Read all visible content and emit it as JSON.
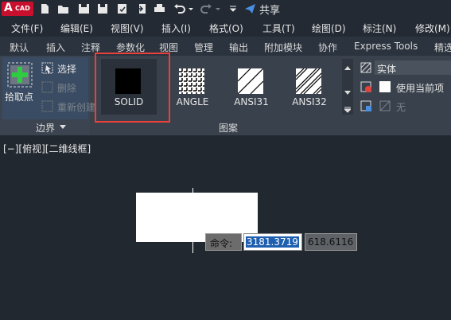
{
  "app": {
    "logo_letter": "A",
    "logo_sub": "CAD",
    "share": "共享"
  },
  "menu": [
    "文件(F)",
    "编辑(E)",
    "视图(V)",
    "插入(I)",
    "格式(O)",
    "工具(T)",
    "绘图(D)",
    "标注(N)",
    "修改(M)"
  ],
  "tabs": [
    "默认",
    "插入",
    "注释",
    "参数化",
    "视图",
    "管理",
    "输出",
    "附加模块",
    "协作",
    "Express Tools",
    "精选"
  ],
  "boundary_panel": {
    "pick_label": "拾取点",
    "select": "选择",
    "delete": "删除",
    "recreate": "重新创建",
    "title": "边界"
  },
  "pattern_panel": {
    "title": "图案",
    "items": [
      {
        "label": "SOLID",
        "icon": "solid-fill-icon"
      },
      {
        "label": "ANGLE",
        "icon": "angle-grid-icon"
      },
      {
        "label": "ANSI31",
        "icon": "ansi31-hatch-icon"
      },
      {
        "label": "ANSI32",
        "icon": "ansi32-hatch-icon"
      }
    ]
  },
  "properties_panel": {
    "hatch_type": "实体",
    "color": "使用当前项",
    "background": "无"
  },
  "viewport": {
    "label": "[−][俯视][二维线框]"
  },
  "command": {
    "prompt": "命令:",
    "x_value": "3181.3719",
    "y_value": "618.6116"
  },
  "colors": {
    "highlight": "#e8403a",
    "accent": "#1f5fb0",
    "logo": "#c8102e"
  }
}
